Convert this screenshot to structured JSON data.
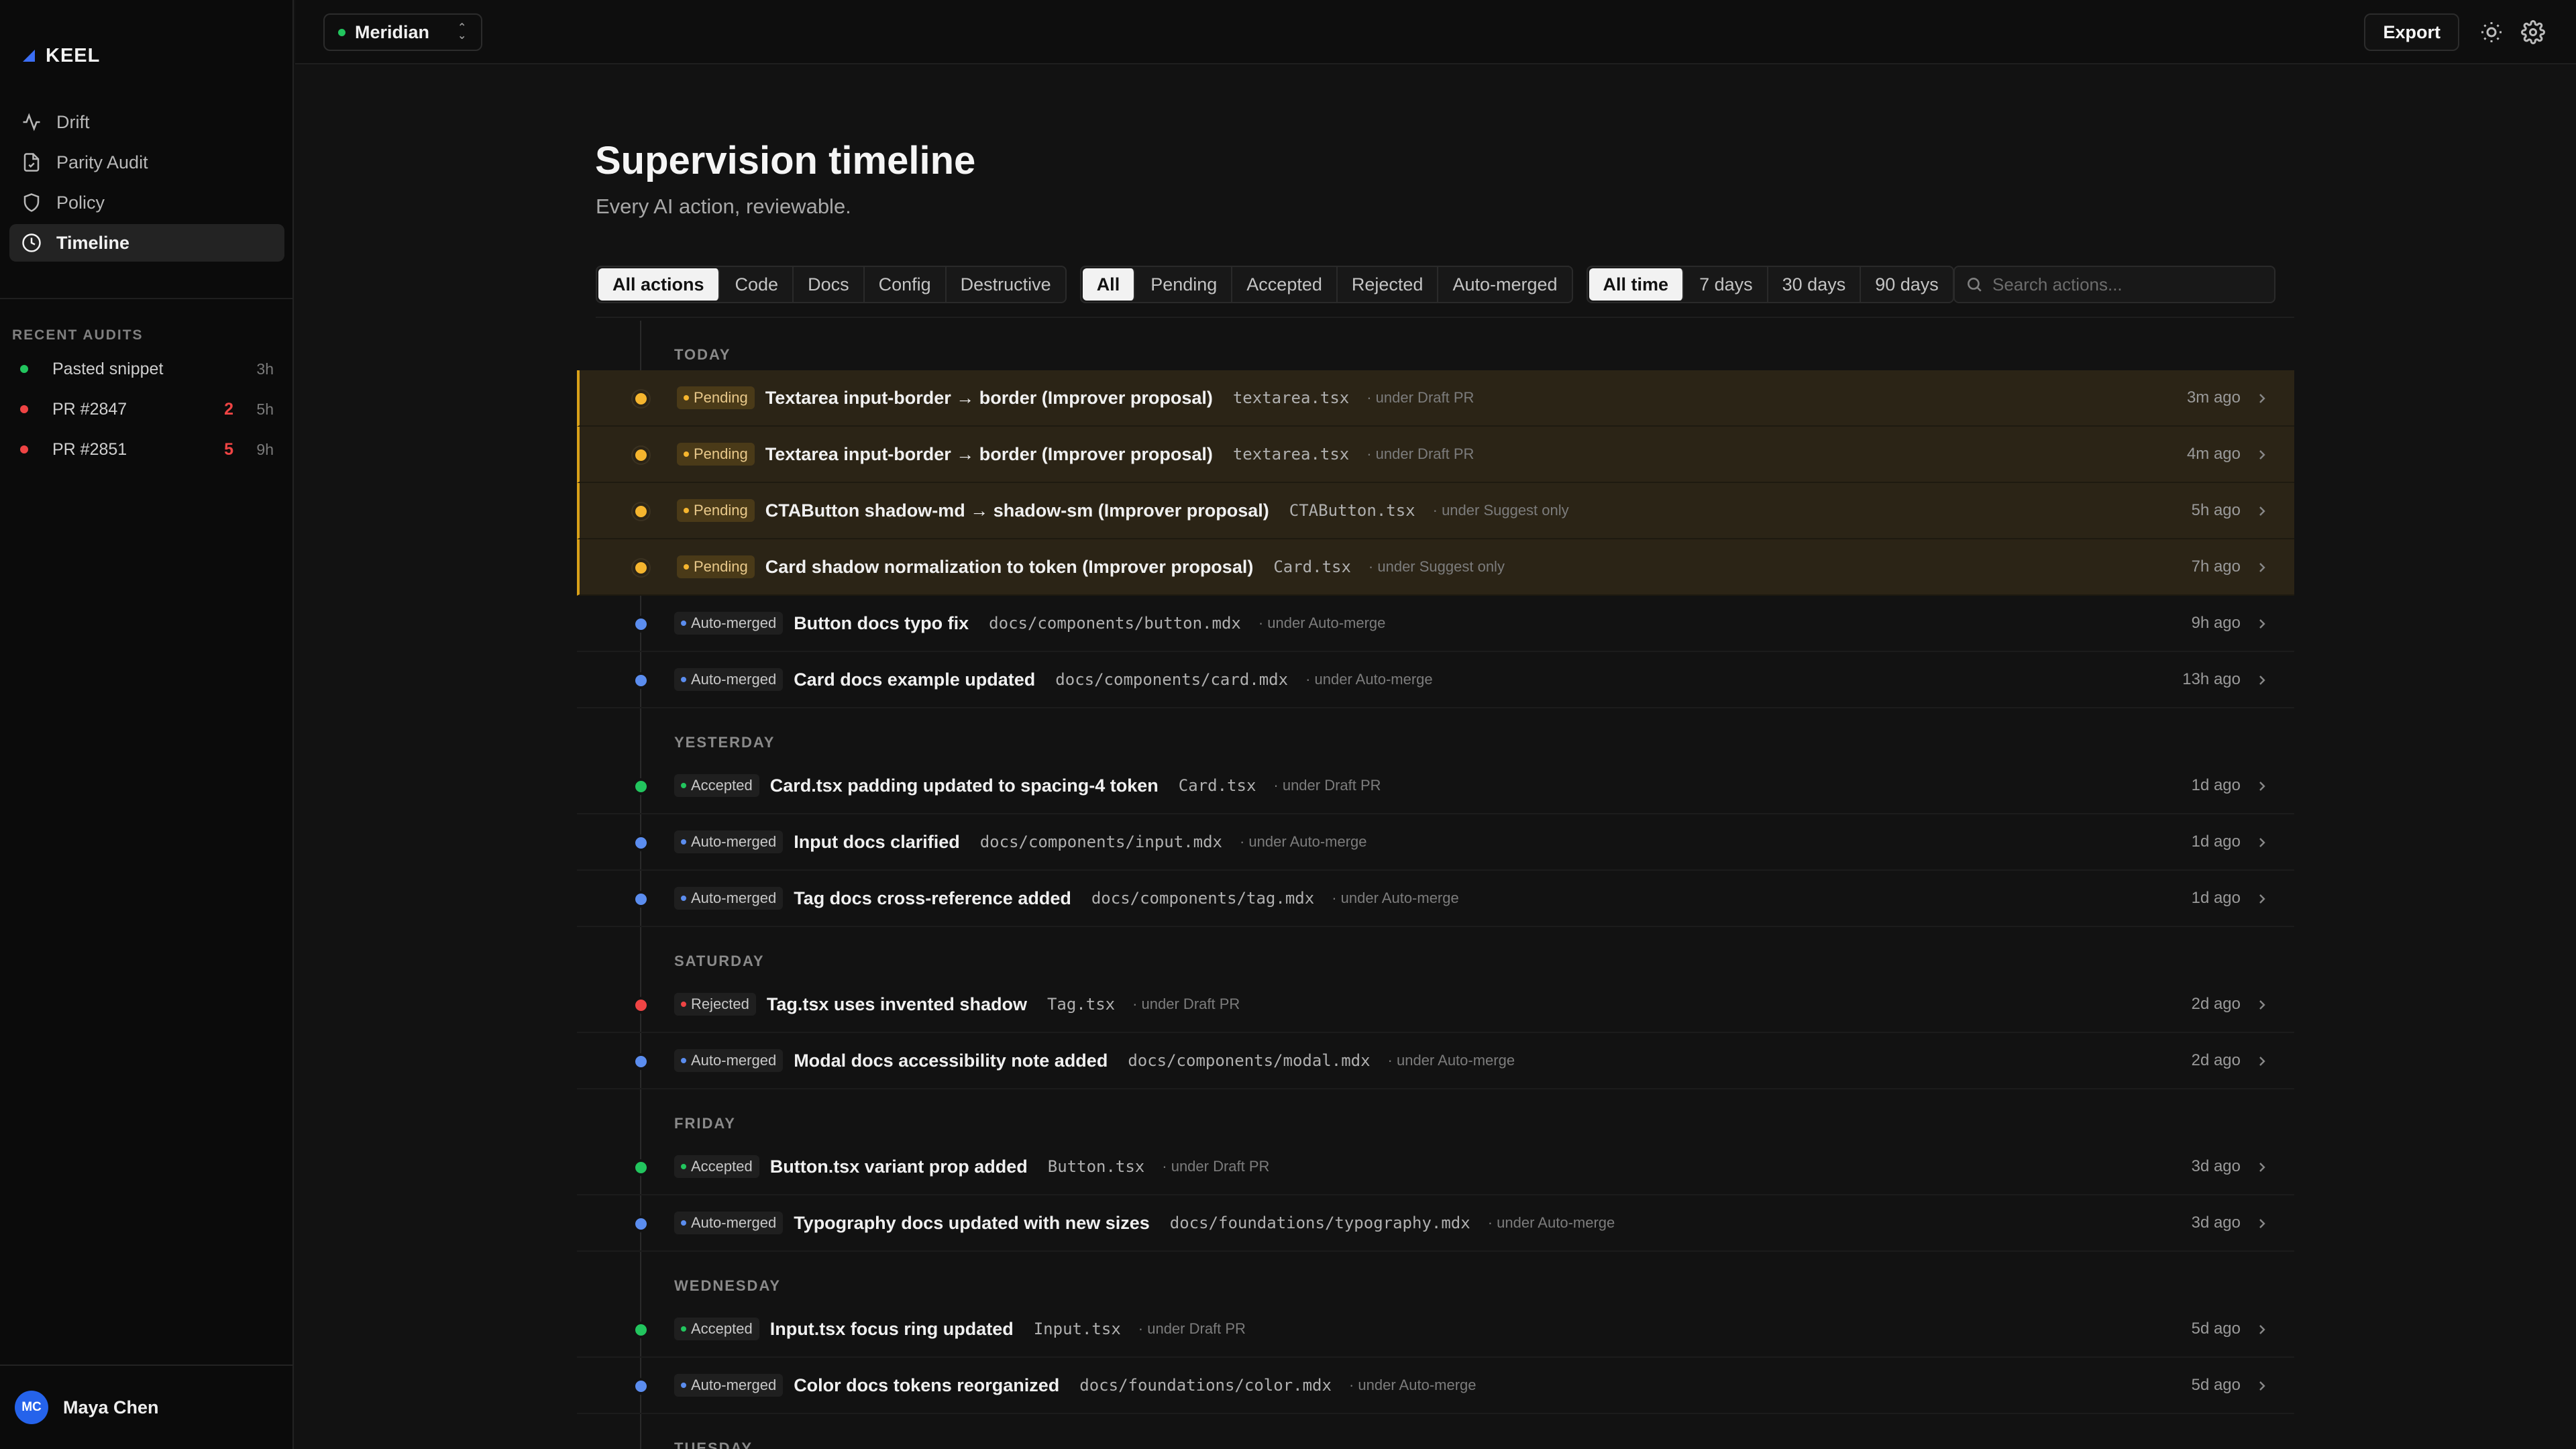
{
  "app": {
    "brand": "KEEL",
    "accent": "#3b6ef5"
  },
  "sidebar": {
    "nav": [
      {
        "label": "Drift",
        "icon": "activity-icon",
        "active": false
      },
      {
        "label": "Parity Audit",
        "icon": "file-check-icon",
        "active": false
      },
      {
        "label": "Policy",
        "icon": "shield-icon",
        "active": false
      },
      {
        "label": "Timeline",
        "icon": "clock-icon",
        "active": true
      }
    ],
    "recent_title": "RECENT AUDITS",
    "recent": [
      {
        "label": "Pasted snippet",
        "count": "",
        "age": "3h",
        "status_color": "#22c55e"
      },
      {
        "label": "PR #2847",
        "count": "2",
        "age": "5h",
        "status_color": "#ef4444"
      },
      {
        "label": "PR #2851",
        "count": "5",
        "age": "9h",
        "status_color": "#ef4444"
      }
    ],
    "user": {
      "initials": "MC",
      "name": "Maya Chen"
    }
  },
  "topbar": {
    "workspace": "Meridian",
    "workspace_status_color": "#22c55e",
    "export_label": "Export"
  },
  "main": {
    "title": "Supervision timeline",
    "subtitle": "Every AI action, reviewable.",
    "filters": {
      "type": [
        {
          "label": "All actions",
          "active": true
        },
        {
          "label": "Code",
          "active": false
        },
        {
          "label": "Docs",
          "active": false
        },
        {
          "label": "Config",
          "active": false
        },
        {
          "label": "Destructive",
          "active": false
        }
      ],
      "status": [
        {
          "label": "All",
          "active": true
        },
        {
          "label": "Pending",
          "active": false
        },
        {
          "label": "Accepted",
          "active": false
        },
        {
          "label": "Rejected",
          "active": false
        },
        {
          "label": "Auto-merged",
          "active": false
        }
      ],
      "range": [
        {
          "label": "All time",
          "active": true
        },
        {
          "label": "7 days",
          "active": false
        },
        {
          "label": "30 days",
          "active": false
        },
        {
          "label": "90 days",
          "active": false
        }
      ]
    },
    "search_placeholder": "Search actions...",
    "status_styles": {
      "Pending": {
        "color": "#f5b52e",
        "bg": "#4a3a18",
        "text": "#e9c98a"
      },
      "Auto-merged": {
        "color": "#5b8def",
        "bg": "#1f1f1f",
        "text": "#c8c8c8"
      },
      "Accepted": {
        "color": "#22c55e",
        "bg": "#1f1f1f",
        "text": "#c8c8c8"
      },
      "Rejected": {
        "color": "#ef4444",
        "bg": "#1f1f1f",
        "text": "#c8c8c8"
      }
    },
    "groups": [
      {
        "label": "TODAY",
        "items": [
          {
            "status": "Pending",
            "title": "Textarea input-border → border (Improver proposal)",
            "file": "textarea.tsx",
            "policy": "· under Draft PR",
            "time": "3m ago"
          },
          {
            "status": "Pending",
            "title": "Textarea input-border → border (Improver proposal)",
            "file": "textarea.tsx",
            "policy": "· under Draft PR",
            "time": "4m ago"
          },
          {
            "status": "Pending",
            "title": "CTAButton shadow-md → shadow-sm (Improver proposal)",
            "file": "CTAButton.tsx",
            "policy": "· under Suggest only",
            "time": "5h ago"
          },
          {
            "status": "Pending",
            "title": "Card shadow normalization to token (Improver proposal)",
            "file": "Card.tsx",
            "policy": "· under Suggest only",
            "time": "7h ago"
          },
          {
            "status": "Auto-merged",
            "title": "Button docs typo fix",
            "file": "docs/components/button.mdx",
            "policy": "· under Auto-merge",
            "time": "9h ago"
          },
          {
            "status": "Auto-merged",
            "title": "Card docs example updated",
            "file": "docs/components/card.mdx",
            "policy": "· under Auto-merge",
            "time": "13h ago"
          }
        ]
      },
      {
        "label": "YESTERDAY",
        "items": [
          {
            "status": "Accepted",
            "title": "Card.tsx padding updated to spacing-4 token",
            "file": "Card.tsx",
            "policy": "· under Draft PR",
            "time": "1d ago"
          },
          {
            "status": "Auto-merged",
            "title": "Input docs clarified",
            "file": "docs/components/input.mdx",
            "policy": "· under Auto-merge",
            "time": "1d ago"
          },
          {
            "status": "Auto-merged",
            "title": "Tag docs cross-reference added",
            "file": "docs/components/tag.mdx",
            "policy": "· under Auto-merge",
            "time": "1d ago"
          }
        ]
      },
      {
        "label": "SATURDAY",
        "items": [
          {
            "status": "Rejected",
            "title": "Tag.tsx uses invented shadow",
            "file": "Tag.tsx",
            "policy": "· under Draft PR",
            "time": "2d ago"
          },
          {
            "status": "Auto-merged",
            "title": "Modal docs accessibility note added",
            "file": "docs/components/modal.mdx",
            "policy": "· under Auto-merge",
            "time": "2d ago"
          }
        ]
      },
      {
        "label": "FRIDAY",
        "items": [
          {
            "status": "Accepted",
            "title": "Button.tsx variant prop added",
            "file": "Button.tsx",
            "policy": "· under Draft PR",
            "time": "3d ago"
          },
          {
            "status": "Auto-merged",
            "title": "Typography docs updated with new sizes",
            "file": "docs/foundations/typography.mdx",
            "policy": "· under Auto-merge",
            "time": "3d ago"
          }
        ]
      },
      {
        "label": "WEDNESDAY",
        "items": [
          {
            "status": "Accepted",
            "title": "Input.tsx focus ring updated",
            "file": "Input.tsx",
            "policy": "· under Draft PR",
            "time": "5d ago"
          },
          {
            "status": "Auto-merged",
            "title": "Color docs tokens reorganized",
            "file": "docs/foundations/color.mdx",
            "policy": "· under Auto-merge",
            "time": "5d ago"
          }
        ]
      },
      {
        "label": "TUESDAY",
        "items": []
      }
    ]
  }
}
